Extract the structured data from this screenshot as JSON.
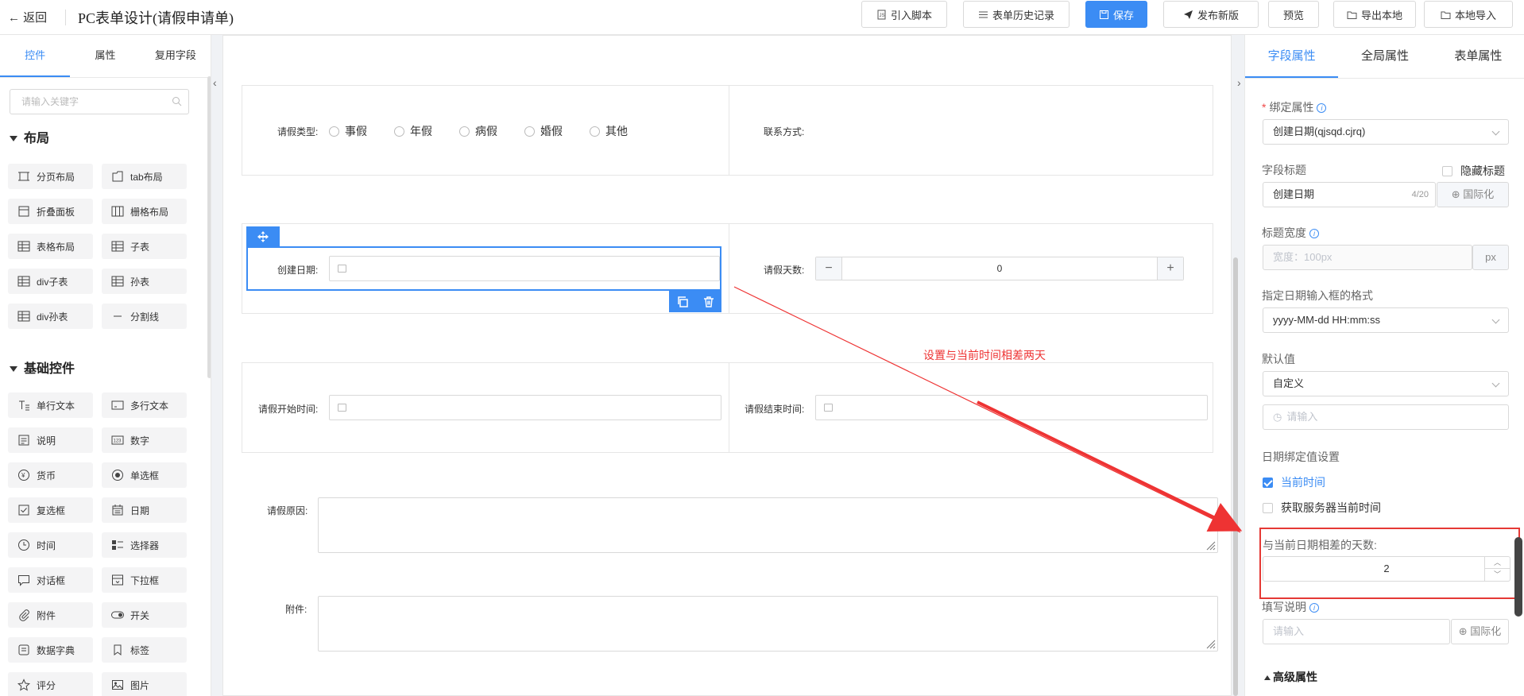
{
  "header": {
    "back_label": "返回",
    "title": "PC表单设计(请假申请单)",
    "buttons": {
      "import_script": "引入脚本",
      "history": "表单历史记录",
      "save": "保存",
      "publish": "发布新版",
      "preview": "预览",
      "export_local": "导出本地",
      "import_local": "本地导入"
    }
  },
  "left_panel": {
    "tabs": [
      "控件",
      "属性",
      "复用字段"
    ],
    "search_placeholder": "请输入关键字",
    "layout_section": "布局",
    "layout_items": [
      "分页布局",
      "tab布局",
      "折叠面板",
      "栅格布局",
      "表格布局",
      "子表",
      "div子表",
      "孙表",
      "div孙表",
      "分割线"
    ],
    "basic_section": "基础控件",
    "basic_items": [
      "单行文本",
      "多行文本",
      "说明",
      "数字",
      "货币",
      "单选框",
      "复选框",
      "日期",
      "时间",
      "选择器",
      "对话框",
      "下拉框",
      "附件",
      "开关",
      "数据字典",
      "标签",
      "评分",
      "图片"
    ]
  },
  "form": {
    "leave_type_label": "请假类型:",
    "leave_types": [
      "事假",
      "年假",
      "病假",
      "婚假",
      "其他"
    ],
    "contact_label": "联系方式:",
    "create_date_label": "创建日期:",
    "leave_days_label": "请假天数:",
    "leave_days_value": "0",
    "start_time_label": "请假开始时间:",
    "end_time_label": "请假结束时间:",
    "reason_label": "请假原因:",
    "attachment_label": "附件:"
  },
  "annotation": "设置与当前时间相差两天",
  "right_panel": {
    "tabs": [
      "字段属性",
      "全局属性",
      "表单属性"
    ],
    "bind_attr_label": "绑定属性",
    "bind_attr_value": "创建日期(qjsqd.cjrq)",
    "field_title_label": "字段标题",
    "hide_title_label": "隐藏标题",
    "field_title_value": "创建日期",
    "field_title_count": "4/20",
    "i18n_label": "国际化",
    "title_width_label": "标题宽度",
    "title_width_placeholder": "宽度：100px",
    "title_width_unit": "px",
    "date_format_label": "指定日期输入框的格式",
    "date_format_value": "yyyy-MM-dd HH:mm:ss",
    "default_value_label": "默认值",
    "default_value_select": "自定义",
    "default_value_placeholder": "请输入",
    "date_binding_label": "日期绑定值设置",
    "current_time_label": "当前时间",
    "server_time_label": "获取服务器当前时间",
    "days_diff_label": "与当前日期相差的天数:",
    "days_diff_value": "2",
    "fill_desc_label": "填写说明",
    "fill_desc_placeholder": "请输入",
    "advanced_label": "高级属性"
  },
  "colors": {
    "primary": "#3b8cf4",
    "annotation": "#ee3333"
  }
}
